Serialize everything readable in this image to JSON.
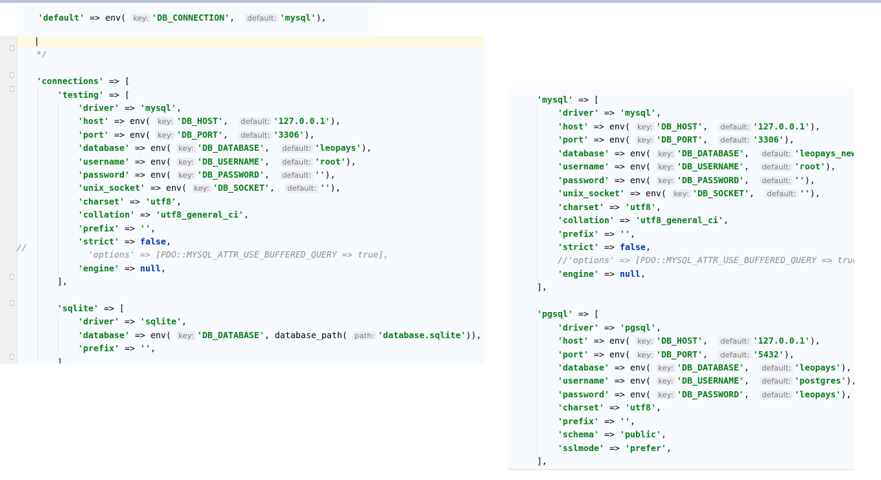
{
  "panels": [
    {
      "id": "default-strip",
      "lines": [
        [
          {
            "t": "'default'",
            "c": "s"
          },
          {
            "t": " => env( "
          },
          {
            "t": "key:",
            "c": "h"
          },
          {
            "t": "'DB_CONNECTION'",
            "c": "s"
          },
          {
            "t": ",  "
          },
          {
            "t": "default:",
            "c": "h"
          },
          {
            "t": "'mysql'",
            "c": "s"
          },
          {
            "t": "),"
          }
        ]
      ]
    },
    {
      "id": "left-editor",
      "lines": [
        [
          {
            "t": "|",
            "c": "caret"
          }
        ],
        [
          {
            "t": "*/",
            "c": "c"
          }
        ],
        [],
        [
          {
            "t": "'connections'",
            "c": "s"
          },
          {
            "t": " => ["
          }
        ],
        [
          {
            "t": "    "
          },
          {
            "t": "'testing'",
            "c": "s"
          },
          {
            "t": " => ["
          }
        ],
        [
          {
            "t": "        "
          },
          {
            "t": "'driver'",
            "c": "s"
          },
          {
            "t": " => "
          },
          {
            "t": "'mysql'",
            "c": "s"
          },
          {
            "t": ","
          }
        ],
        [
          {
            "t": "        "
          },
          {
            "t": "'host'",
            "c": "s"
          },
          {
            "t": " => env( "
          },
          {
            "t": "key:",
            "c": "h"
          },
          {
            "t": "'DB_HOST'",
            "c": "s"
          },
          {
            "t": ",  "
          },
          {
            "t": "default:",
            "c": "h"
          },
          {
            "t": "'127.0.0.1'",
            "c": "s"
          },
          {
            "t": "),"
          }
        ],
        [
          {
            "t": "        "
          },
          {
            "t": "'port'",
            "c": "s"
          },
          {
            "t": " => env( "
          },
          {
            "t": "key:",
            "c": "h"
          },
          {
            "t": "'DB_PORT'",
            "c": "s"
          },
          {
            "t": ",  "
          },
          {
            "t": "default:",
            "c": "h"
          },
          {
            "t": "'3306'",
            "c": "s"
          },
          {
            "t": "),"
          }
        ],
        [
          {
            "t": "        "
          },
          {
            "t": "'database'",
            "c": "s"
          },
          {
            "t": " => env( "
          },
          {
            "t": "key:",
            "c": "h"
          },
          {
            "t": "'DB_DATABASE'",
            "c": "s"
          },
          {
            "t": ",  "
          },
          {
            "t": "default:",
            "c": "h"
          },
          {
            "t": "'leopays'",
            "c": "s"
          },
          {
            "t": "),"
          }
        ],
        [
          {
            "t": "        "
          },
          {
            "t": "'username'",
            "c": "s"
          },
          {
            "t": " => env( "
          },
          {
            "t": "key:",
            "c": "h"
          },
          {
            "t": "'DB_USERNAME'",
            "c": "s"
          },
          {
            "t": ",  "
          },
          {
            "t": "default:",
            "c": "h"
          },
          {
            "t": "'root'",
            "c": "s"
          },
          {
            "t": "),"
          }
        ],
        [
          {
            "t": "        "
          },
          {
            "t": "'password'",
            "c": "s"
          },
          {
            "t": " => env( "
          },
          {
            "t": "key:",
            "c": "h"
          },
          {
            "t": "'DB_PASSWORD'",
            "c": "s"
          },
          {
            "t": ",  "
          },
          {
            "t": "default:",
            "c": "h"
          },
          {
            "t": "''",
            "c": "s"
          },
          {
            "t": "),"
          }
        ],
        [
          {
            "t": "        "
          },
          {
            "t": "'unix_socket'",
            "c": "s"
          },
          {
            "t": " => env( "
          },
          {
            "t": "key:",
            "c": "h"
          },
          {
            "t": "'DB_SOCKET'",
            "c": "s"
          },
          {
            "t": ",  "
          },
          {
            "t": "default:",
            "c": "h"
          },
          {
            "t": "''",
            "c": "s"
          },
          {
            "t": "),"
          }
        ],
        [
          {
            "t": "        "
          },
          {
            "t": "'charset'",
            "c": "s"
          },
          {
            "t": " => "
          },
          {
            "t": "'utf8'",
            "c": "s"
          },
          {
            "t": ","
          }
        ],
        [
          {
            "t": "        "
          },
          {
            "t": "'collation'",
            "c": "s"
          },
          {
            "t": " => "
          },
          {
            "t": "'utf8_general_ci'",
            "c": "s"
          },
          {
            "t": ","
          }
        ],
        [
          {
            "t": "        "
          },
          {
            "t": "'prefix'",
            "c": "s"
          },
          {
            "t": " => "
          },
          {
            "t": "''",
            "c": "s"
          },
          {
            "t": ","
          }
        ],
        [
          {
            "t": "        "
          },
          {
            "t": "'strict'",
            "c": "s"
          },
          {
            "t": " => "
          },
          {
            "t": "false",
            "c": "k"
          },
          {
            "t": ","
          }
        ],
        [
          {
            "t": "          'options' => [PDO::MYSQL_ATTR_USE_BUFFERED_QUERY => true],",
            "c": "c"
          }
        ],
        [
          {
            "t": "        "
          },
          {
            "t": "'engine'",
            "c": "s"
          },
          {
            "t": " => "
          },
          {
            "t": "null",
            "c": "k"
          },
          {
            "t": ","
          }
        ],
        [
          {
            "t": "    ],"
          }
        ],
        [],
        [
          {
            "t": "    "
          },
          {
            "t": "'sqlite'",
            "c": "s"
          },
          {
            "t": " => ["
          }
        ],
        [
          {
            "t": "        "
          },
          {
            "t": "'driver'",
            "c": "s"
          },
          {
            "t": " => "
          },
          {
            "t": "'sqlite'",
            "c": "s"
          },
          {
            "t": ","
          }
        ],
        [
          {
            "t": "        "
          },
          {
            "t": "'database'",
            "c": "s"
          },
          {
            "t": " => env( "
          },
          {
            "t": "key:",
            "c": "h"
          },
          {
            "t": "'DB_DATABASE'",
            "c": "s"
          },
          {
            "t": ", database_path( "
          },
          {
            "t": "path:",
            "c": "h"
          },
          {
            "t": "'database.sqlite'",
            "c": "s"
          },
          {
            "t": ")),"
          }
        ],
        [
          {
            "t": "        "
          },
          {
            "t": "'prefix'",
            "c": "s"
          },
          {
            "t": " => "
          },
          {
            "t": "''",
            "c": "s"
          },
          {
            "t": ","
          }
        ],
        [
          {
            "t": "    ],"
          }
        ]
      ],
      "gutter_comment": "//"
    },
    {
      "id": "right-editor",
      "lines": [
        [
          {
            "t": "'mysql'",
            "c": "s"
          },
          {
            "t": " => ["
          }
        ],
        [
          {
            "t": "    "
          },
          {
            "t": "'driver'",
            "c": "s"
          },
          {
            "t": " => "
          },
          {
            "t": "'mysql'",
            "c": "s"
          },
          {
            "t": ","
          }
        ],
        [
          {
            "t": "    "
          },
          {
            "t": "'host'",
            "c": "s"
          },
          {
            "t": " => env( "
          },
          {
            "t": "key:",
            "c": "h"
          },
          {
            "t": "'DB_HOST'",
            "c": "s"
          },
          {
            "t": ",  "
          },
          {
            "t": "default:",
            "c": "h"
          },
          {
            "t": "'127.0.0.1'",
            "c": "s"
          },
          {
            "t": "),"
          }
        ],
        [
          {
            "t": "    "
          },
          {
            "t": "'port'",
            "c": "s"
          },
          {
            "t": " => env( "
          },
          {
            "t": "key:",
            "c": "h"
          },
          {
            "t": "'DB_PORT'",
            "c": "s"
          },
          {
            "t": ",  "
          },
          {
            "t": "default:",
            "c": "h"
          },
          {
            "t": "'3306'",
            "c": "s"
          },
          {
            "t": "),"
          }
        ],
        [
          {
            "t": "    "
          },
          {
            "t": "'database'",
            "c": "s"
          },
          {
            "t": " => env( "
          },
          {
            "t": "key:",
            "c": "h"
          },
          {
            "t": "'DB_DATABASE'",
            "c": "s"
          },
          {
            "t": ",  "
          },
          {
            "t": "default:",
            "c": "h"
          },
          {
            "t": "'leopays_new'",
            "c": "s"
          },
          {
            "t": "),"
          }
        ],
        [
          {
            "t": "    "
          },
          {
            "t": "'username'",
            "c": "s"
          },
          {
            "t": " => env( "
          },
          {
            "t": "key:",
            "c": "h"
          },
          {
            "t": "'DB_USERNAME'",
            "c": "s"
          },
          {
            "t": ",  "
          },
          {
            "t": "default:",
            "c": "h"
          },
          {
            "t": "'root'",
            "c": "s"
          },
          {
            "t": "),"
          }
        ],
        [
          {
            "t": "    "
          },
          {
            "t": "'password'",
            "c": "s"
          },
          {
            "t": " => env( "
          },
          {
            "t": "key:",
            "c": "h"
          },
          {
            "t": "'DB_PASSWORD'",
            "c": "s"
          },
          {
            "t": ",  "
          },
          {
            "t": "default:",
            "c": "h"
          },
          {
            "t": "''",
            "c": "s"
          },
          {
            "t": "),"
          }
        ],
        [
          {
            "t": "    "
          },
          {
            "t": "'unix_socket'",
            "c": "s"
          },
          {
            "t": " => env( "
          },
          {
            "t": "key:",
            "c": "h"
          },
          {
            "t": "'DB_SOCKET'",
            "c": "s"
          },
          {
            "t": ",  "
          },
          {
            "t": "default:",
            "c": "h"
          },
          {
            "t": "''",
            "c": "s"
          },
          {
            "t": "),"
          }
        ],
        [
          {
            "t": "    "
          },
          {
            "t": "'charset'",
            "c": "s"
          },
          {
            "t": " => "
          },
          {
            "t": "'utf8'",
            "c": "s"
          },
          {
            "t": ","
          }
        ],
        [
          {
            "t": "    "
          },
          {
            "t": "'collation'",
            "c": "s"
          },
          {
            "t": " => "
          },
          {
            "t": "'utf8_general_ci'",
            "c": "s"
          },
          {
            "t": ","
          }
        ],
        [
          {
            "t": "    "
          },
          {
            "t": "'prefix'",
            "c": "s"
          },
          {
            "t": " => "
          },
          {
            "t": "''",
            "c": "s"
          },
          {
            "t": ","
          }
        ],
        [
          {
            "t": "    "
          },
          {
            "t": "'strict'",
            "c": "s"
          },
          {
            "t": " => "
          },
          {
            "t": "false",
            "c": "k"
          },
          {
            "t": ","
          }
        ],
        [
          {
            "t": "    //'options' => [PDO::MYSQL_ATTR_USE_BUFFERED_QUERY => true],",
            "c": "c"
          }
        ],
        [
          {
            "t": "    "
          },
          {
            "t": "'engine'",
            "c": "s"
          },
          {
            "t": " => "
          },
          {
            "t": "null",
            "c": "k"
          },
          {
            "t": ","
          }
        ],
        [
          {
            "t": "],"
          }
        ],
        [],
        [
          {
            "t": "'pgsql'",
            "c": "s"
          },
          {
            "t": " => ["
          }
        ],
        [
          {
            "t": "    "
          },
          {
            "t": "'driver'",
            "c": "s"
          },
          {
            "t": " => "
          },
          {
            "t": "'pgsql'",
            "c": "s"
          },
          {
            "t": ","
          }
        ],
        [
          {
            "t": "    "
          },
          {
            "t": "'host'",
            "c": "s"
          },
          {
            "t": " => env( "
          },
          {
            "t": "key:",
            "c": "h"
          },
          {
            "t": "'DB_HOST'",
            "c": "s"
          },
          {
            "t": ",  "
          },
          {
            "t": "default:",
            "c": "h"
          },
          {
            "t": "'127.0.0.1'",
            "c": "s"
          },
          {
            "t": "),"
          }
        ],
        [
          {
            "t": "    "
          },
          {
            "t": "'port'",
            "c": "s"
          },
          {
            "t": " => env( "
          },
          {
            "t": "key:",
            "c": "h"
          },
          {
            "t": "'DB_PORT'",
            "c": "s"
          },
          {
            "t": ",  "
          },
          {
            "t": "default:",
            "c": "h"
          },
          {
            "t": "'5432'",
            "c": "s"
          },
          {
            "t": "),"
          }
        ],
        [
          {
            "t": "    "
          },
          {
            "t": "'database'",
            "c": "s"
          },
          {
            "t": " => env( "
          },
          {
            "t": "key:",
            "c": "h"
          },
          {
            "t": "'DB_DATABASE'",
            "c": "s"
          },
          {
            "t": ",  "
          },
          {
            "t": "default:",
            "c": "h"
          },
          {
            "t": "'leopays'",
            "c": "s"
          },
          {
            "t": "),"
          }
        ],
        [
          {
            "t": "    "
          },
          {
            "t": "'username'",
            "c": "s"
          },
          {
            "t": " => env( "
          },
          {
            "t": "key:",
            "c": "h"
          },
          {
            "t": "'DB_USERNAME'",
            "c": "s"
          },
          {
            "t": ",  "
          },
          {
            "t": "default:",
            "c": "h"
          },
          {
            "t": "'postgres'",
            "c": "s"
          },
          {
            "t": "),"
          }
        ],
        [
          {
            "t": "    "
          },
          {
            "t": "'password'",
            "c": "s"
          },
          {
            "t": " => env( "
          },
          {
            "t": "key:",
            "c": "h"
          },
          {
            "t": "'DB_PASSWORD'",
            "c": "s"
          },
          {
            "t": ",  "
          },
          {
            "t": "default:",
            "c": "h"
          },
          {
            "t": "'leopays'",
            "c": "s"
          },
          {
            "t": "),"
          }
        ],
        [
          {
            "t": "    "
          },
          {
            "t": "'charset'",
            "c": "s"
          },
          {
            "t": " => "
          },
          {
            "t": "'utf8'",
            "c": "s"
          },
          {
            "t": ","
          }
        ],
        [
          {
            "t": "    "
          },
          {
            "t": "'prefix'",
            "c": "s"
          },
          {
            "t": " => "
          },
          {
            "t": "''",
            "c": "s"
          },
          {
            "t": ","
          }
        ],
        [
          {
            "t": "    "
          },
          {
            "t": "'schema'",
            "c": "s"
          },
          {
            "t": " => "
          },
          {
            "t": "'public'",
            "c": "s"
          },
          {
            "t": ","
          }
        ],
        [
          {
            "t": "    "
          },
          {
            "t": "'sslmode'",
            "c": "s"
          },
          {
            "t": " => "
          },
          {
            "t": "'prefer'",
            "c": "s"
          },
          {
            "t": ","
          }
        ],
        [
          {
            "t": "],"
          }
        ]
      ]
    }
  ]
}
